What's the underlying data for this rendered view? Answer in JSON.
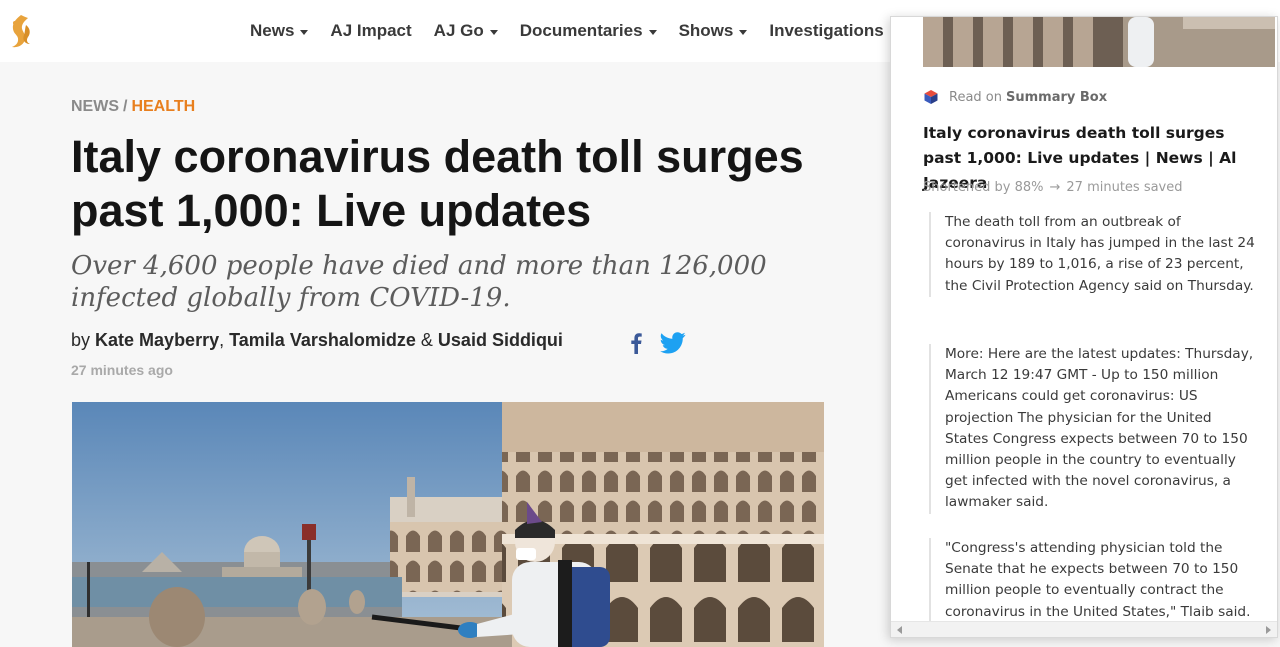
{
  "nav": {
    "items": [
      {
        "label": "News",
        "dropdown": true
      },
      {
        "label": "AJ Impact",
        "dropdown": false
      },
      {
        "label": "AJ Go",
        "dropdown": true
      },
      {
        "label": "Documentaries",
        "dropdown": true
      },
      {
        "label": "Shows",
        "dropdown": true
      },
      {
        "label": "Investigations",
        "dropdown": false
      }
    ]
  },
  "article": {
    "breadcrumb": {
      "section": "NEWS",
      "separator": "/",
      "category": "HEALTH"
    },
    "headline": "Italy coronavirus death toll surges past 1,000: Live updates",
    "subheadline": "Over 4,600 people have died and more than 126,000 infected globally from COVID-19.",
    "byline": {
      "prefix": "by",
      "authors": [
        "Kate Mayberry",
        "Tamila Varshalomidze",
        "Usaid Siddiqui"
      ],
      "separators": [
        ",",
        "&"
      ]
    },
    "timestamp": "27 minutes ago"
  },
  "summary_panel": {
    "read_on_prefix": "Read on",
    "brand": "Summary Box",
    "title": "Italy coronavirus death toll surges past 1,000: Live updates | News | Al Jazeera",
    "stats": {
      "shortened": "Shortened by 88%",
      "arrow": "→",
      "saved": "27 minutes saved"
    },
    "paragraphs": [
      "The death toll from an outbreak of coronavirus in Italy has jumped in the last 24 hours by 189 to 1,016, a rise of 23 percent, the Civil Protection Agency said on Thursday.",
      "More: Here are the latest updates: Thursday, March 12 19:47 GMT - Up to 150 million Americans could get coronavirus: US projection The physician for the United States Congress expects between 70 to 150 million people in the country to eventually get infected with the novel coronavirus, a lawmaker said.",
      "\"Congress's attending physician told the Senate that he expects between 70 to 150 million people to eventually contract the coronavirus in the United States,\" Tlaib said."
    ]
  },
  "icons": {
    "logo": "al-jazeera-logo-icon",
    "facebook": "facebook-icon",
    "twitter": "twitter-icon",
    "summary": "summary-box-cube-icon"
  },
  "colors": {
    "accent": "#e87f1e",
    "facebook": "#3b5998",
    "twitter": "#1da1f2",
    "logo": "#e8a33c"
  }
}
